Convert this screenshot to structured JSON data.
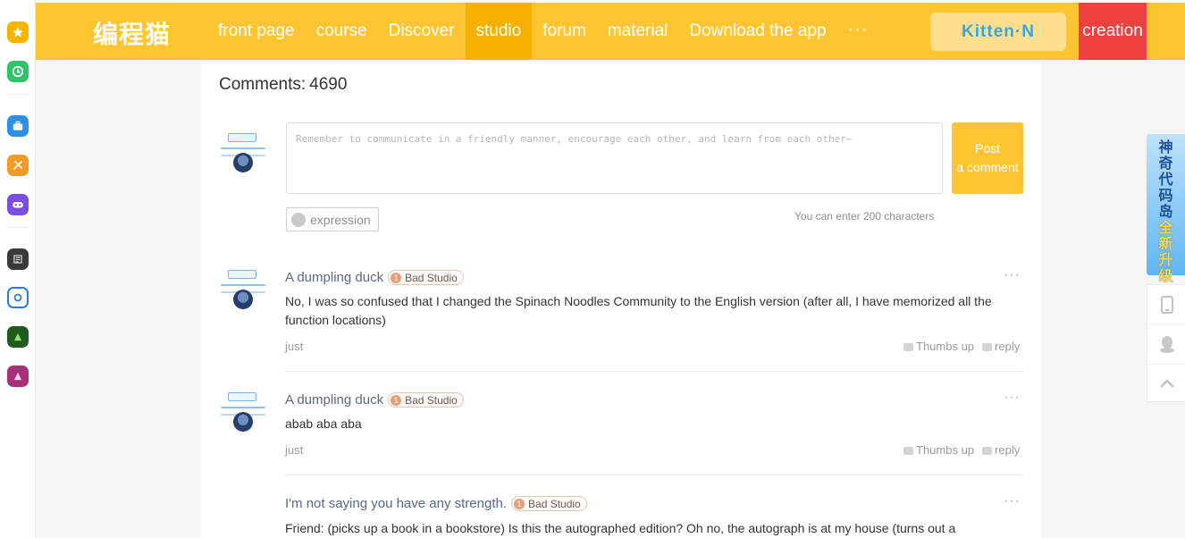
{
  "brand": {
    "logo_text": "编程猫",
    "accent": "#ffc531",
    "active_tab": "#f5b000",
    "creation_color": "#f0403f"
  },
  "rail": {
    "items": [
      "star-icon",
      "clock-icon",
      "briefcase-icon",
      "tools-icon",
      "gamepad-icon",
      "app-long-icon",
      "app-ring-icon",
      "app-green-icon",
      "app-pink-icon"
    ]
  },
  "nav": {
    "items": [
      {
        "label": "front page"
      },
      {
        "label": "course"
      },
      {
        "label": "Discover"
      },
      {
        "label": "studio",
        "active": true
      },
      {
        "label": "forum"
      },
      {
        "label": "material"
      },
      {
        "label": "Download the app"
      }
    ],
    "more": "···",
    "kitten_label": "Kitten·N",
    "creation_label": "creation"
  },
  "comments": {
    "count_label": "Comments:",
    "count": "4690",
    "editor": {
      "placeholder": "Remember to communicate in a friendly manner, encourage each other, and learn from each other~",
      "post_line1": "Post",
      "post_line2": "a comment",
      "expression_label": "expression",
      "char_hint": "You can enter 200 characters"
    },
    "list": [
      {
        "author": "A dumpling duck",
        "level": "1",
        "studio": "Bad Studio",
        "text": "No, I was so confused that I changed the Spinach Noodles Community to the English version (after all, I have memorized all the function locations)",
        "time": "just",
        "like_label": "Thumbs up",
        "reply_label": "reply"
      },
      {
        "author": "A dumpling duck",
        "level": "1",
        "studio": "Bad Studio",
        "text": "abab aba aba",
        "time": "just",
        "like_label": "Thumbs up",
        "reply_label": "reply"
      },
      {
        "author": "I'm not saying you have any strength.",
        "level": "1",
        "studio": "Bad Studio",
        "text": "Friend: (picks up a book in a bookstore) Is this the autographed edition? Oh no, the autograph is at my house (turns out a"
      }
    ]
  },
  "sidebar": {
    "promo_line1": [
      "神",
      "奇",
      "代",
      "码",
      "岛"
    ],
    "promo_line2": [
      "全",
      "新",
      "升",
      "级"
    ],
    "tools": [
      "mobile-icon",
      "qq-icon",
      "back-to-top-icon"
    ]
  }
}
